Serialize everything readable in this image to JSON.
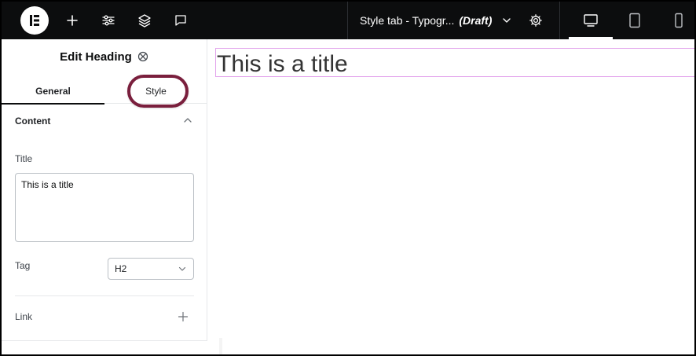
{
  "topbar": {
    "logo_icon": "elementor-logo",
    "add_icon": "plus-icon",
    "site_settings_icon": "sliders-icon",
    "structure_icon": "layers-icon",
    "notes_icon": "chat-icon",
    "doc_title": "Style tab - Typogr...",
    "doc_status": "(Draft)",
    "page_settings_icon": "gear-icon",
    "devices": [
      "desktop-icon",
      "tablet-icon",
      "mobile-icon"
    ],
    "active_device": "desktop"
  },
  "panel": {
    "title": "Edit Heading",
    "title_icon": "widgets-icon",
    "tabs": [
      {
        "label": "General",
        "active": true
      },
      {
        "label": "Style",
        "active": false
      }
    ],
    "section": {
      "title": "Content",
      "expanded": true
    },
    "fields": {
      "title_label": "Title",
      "title_value": "This is a title",
      "tag_label": "Tag",
      "tag_value": "H2",
      "link_label": "Link"
    }
  },
  "canvas": {
    "heading": "This is a title"
  },
  "colors": {
    "topbar_bg": "#0c0d0e",
    "highlight_ring": "#7a1f3d",
    "heading_outline": "#e2a3ec"
  }
}
